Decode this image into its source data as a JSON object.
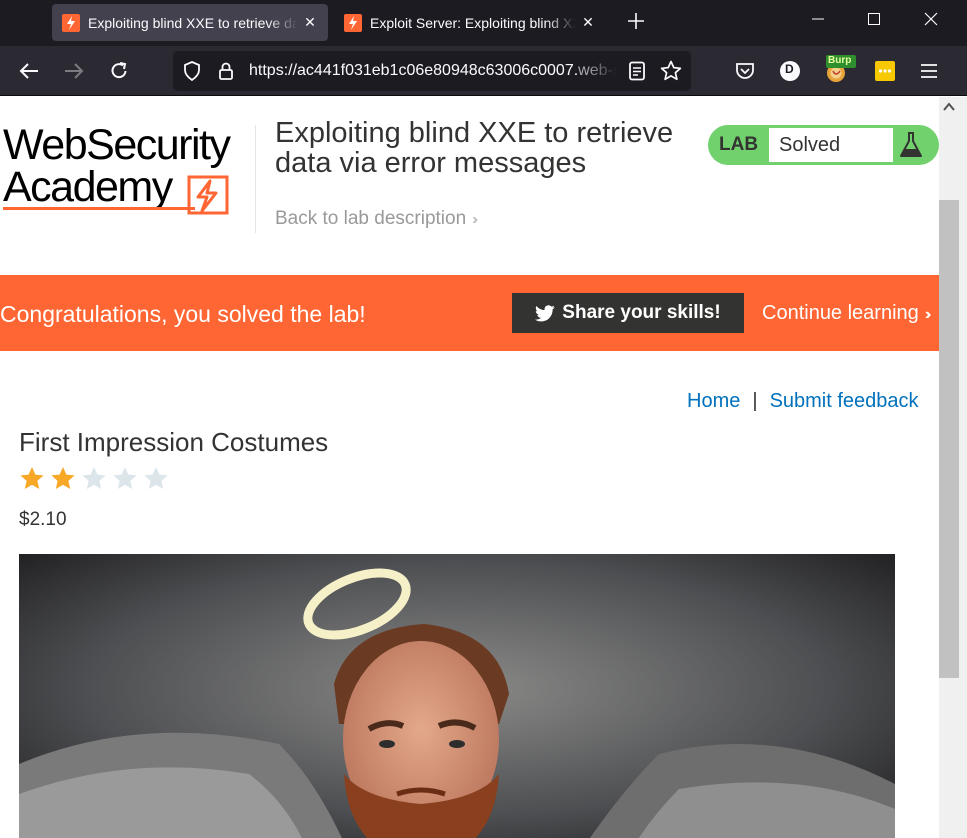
{
  "browser": {
    "tabs": [
      {
        "title": "Exploiting blind XXE to retrieve data via error messages",
        "active": true
      },
      {
        "title": "Exploit Server: Exploiting blind XXE to retrieve data via error messages",
        "active": false
      }
    ],
    "url_main": "https://ac441f031eb1c06e80948c63006c0007.",
    "url_dim": "web-security-academy.net",
    "extensions": [
      "pocket-icon",
      "profile-icon",
      "burp-icon",
      "password-icon",
      "menu-icon"
    ],
    "profile_initial": "D",
    "burp_label": "Burp"
  },
  "header": {
    "logo_line1": "WebSecurity",
    "logo_line2": "Academy",
    "lab_title": "Exploiting blind XXE to retrieve data via error messages",
    "back_link": "Back to lab description",
    "badge_label": "LAB",
    "badge_status": "Solved"
  },
  "banner": {
    "message": "Congratulations, you solved the lab!",
    "share_label": "Share your skills!",
    "continue_label": "Continue learning"
  },
  "nav": {
    "home": "Home",
    "separator": "|",
    "feedback": "Submit feedback"
  },
  "product": {
    "name": "First Impression Costumes",
    "rating": 2,
    "max_rating": 5,
    "price": "$2.10"
  },
  "colors": {
    "brand_orange": "#ff6633",
    "lab_green": "#70d16d",
    "link_blue": "#0071bc",
    "star_filled": "#f7a826",
    "star_empty": "#dce6ea"
  }
}
